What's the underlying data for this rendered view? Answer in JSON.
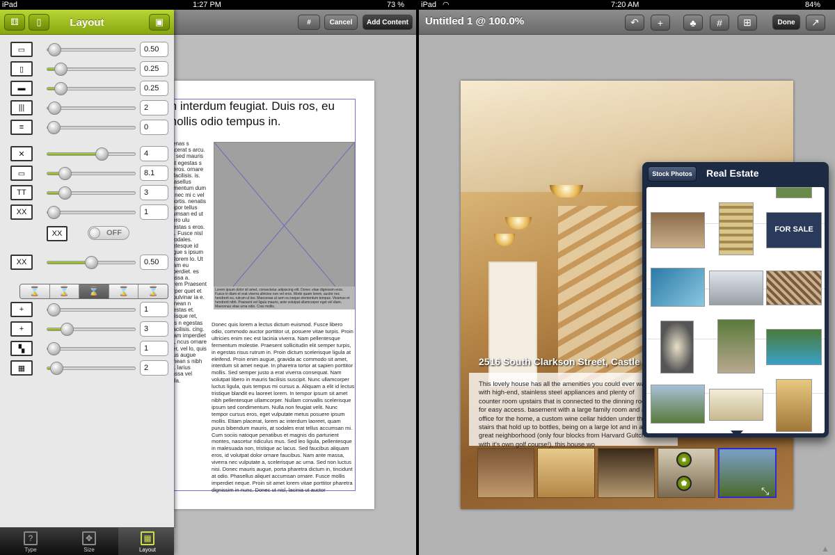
{
  "left": {
    "status": {
      "device": "iPad",
      "time": "1:27 PM",
      "battery": "73 %"
    },
    "toolbar": {
      "cancel": "Cancel",
      "add_content": "Add Content"
    },
    "panel": {
      "title": "Layout",
      "rows": [
        {
          "icon": "▭",
          "value": "0.50",
          "level": 0.08
        },
        {
          "icon": "▯",
          "value": "0.25",
          "level": 0.15
        },
        {
          "icon": "▬",
          "value": "0.25",
          "level": 0.15
        },
        {
          "icon": "|||",
          "value": "2",
          "level": 0.08
        },
        {
          "icon": "≡",
          "value": "0",
          "level": 0.0
        },
        {
          "icon": "✕",
          "value": "4",
          "level": 0.62
        },
        {
          "icon": "▭",
          "value": "8.1",
          "level": 0.2
        },
        {
          "icon": "TT",
          "value": "3",
          "level": 0.2
        },
        {
          "icon": "XX",
          "value": "1",
          "level": 0.05
        },
        {
          "icon": "XX",
          "value": "0.50",
          "level": 0.5
        },
        {
          "icon": "+",
          "value": "1",
          "level": 0.0
        },
        {
          "icon": "+",
          "value": "3",
          "level": 0.22
        },
        {
          "icon": "▚",
          "value": "1",
          "level": 0.0
        },
        {
          "icon": "▦",
          "value": "2",
          "level": 0.1
        }
      ],
      "toggle": "OFF",
      "segments": [
        "⌛",
        "⌛",
        "⌛",
        "⌛",
        "⌛"
      ],
      "tabs": [
        {
          "label": "Type",
          "icon": "?"
        },
        {
          "label": "Size",
          "icon": "✥"
        },
        {
          "label": "Layout",
          "icon": "▦"
        }
      ]
    },
    "doc": {
      "heading": "m interdum feugiat. Duis ros, eu mollis odio tempus in.",
      "col1": "scenas s placerat s arcu. us, sed mauris a ut egestas s ut eros. ornare or facilisis. is. Phasellus fermentum dum ed nec mi c vel lobortis. nenatis ompor tellus ccumsan ed ut libero ulu egestas s eros. ula. Fusce nisl s sodales. llentesque id augue s ipsum ac lorem lo. Ut quam eu imperdiet. es massa a. Lorem Praesent corper quet et s, pulvinar ia e. Aenean n egestas et. Quisque ret, felis n egestas s facilisis. cing. Etiam imperdiet elit, ncus ornare liber, vel lo, quis ncus augue nenean s nibh elit. larius massa vel nulla.",
      "col2": "Donec quis lorem a lectus dictum euismod. Fusce libero odio, commodo auctor porttitor ut, posuere vitae turpis. Proin ultricies enim nec est lacinia viverra. Nam pellentesque fermentum molestie. Praesent sollicitudin elit semper turpis, in egestas risus rutrum in. Proin dictum scelerisque ligula at eleifend. Proin enim augue, gravida ac commodo sit amet, interdum sit amet neque. In pharetra tortor at sapien porttitor mollis. Sed semper justo a erat viverra consequat. Nam volutpat libero in mauris facilisis suscipit. Nunc ullamcorper luctus ligula, quis tempus mi cursus a. Aliquam a elit id lectus tristique blandit eu laoreet lorem. In tempor ipsum sit amet nibh pellentesque ullamcorper. Nullam convallis scelerisque ipsum sed condimentum. Nulla non feugiat velit. Nunc tempor cursus eros, eget vulputate metus posuere ipsum mollis. Etiam placerat, lorem ac interdum laoreet, quam purus bibendum mauris, at sodales erat tellus accumsan mi. Cum sociis natoque penatibus et magnis dis parturient montes, nascetur ridiculus mus. Sed leo ligula, pellentesque in malesuada non, tristique ac lacus. Sed faucibus aliquam eros, id volutpat dolor ornare faucibus. Nam ante massa, viverra nec vulputate a, scelerisque ac urna. Sed non luctus nisi. Donec mauris augue, porta pharetra dictum in, tincidunt at odio. Phasellus aliquet accumsan ornare. Fusce mollis imperdiet neque. Proin sit amet lorem vitae porttitor pharetra dignissim in nunc. Donec ut nisl, lacinia ut auctor",
      "caption": "Lorem ipsum dolor sit amet, consectetur adipiscing elit. Donec vitae dignissim eros. Fusce in diam et erat viverra ultricies non vel eros. Morbi quam lorem, auctor nec hendrerit eu, rutrum ut leo. Maecenas ut sem eu neque elementum tempus. Vivamus et hendrerit nibh. Praesent vel ligula mauris, ante volutpat ullamcorper eget vel diam. Maecenas vitae urna odio. Cras mollis."
    }
  },
  "right": {
    "status": {
      "device": "iPad",
      "time": "7:20 AM",
      "battery": "84%"
    },
    "toolbar": {
      "title": "Untitled 1 @ 100.0%",
      "done": "Done"
    },
    "page": {
      "address": "2516 South Clarkson Street, Castle",
      "description": "This lovely house has all the amenities you could ever want with high-end, stainless steel appliances and plenty of counter room upstairs that is connected to the dinning room for easy access. basement with a large family room and an office for the home, a custom wine cellar hidden under the stairs that hold up to bottles, being on a large lot and in a great neighborhood (only four blocks from Harvard Gultch - with it's own golf course!), this house wo"
    },
    "popover": {
      "back": "Stock Photos",
      "title": "Real Estate",
      "sale_sign": "FOR SALE"
    },
    "colors": {
      "panel_green": "#9cbc1c",
      "popover_navy": "#1c2a44",
      "selection_blue": "#2b2bd8"
    }
  }
}
